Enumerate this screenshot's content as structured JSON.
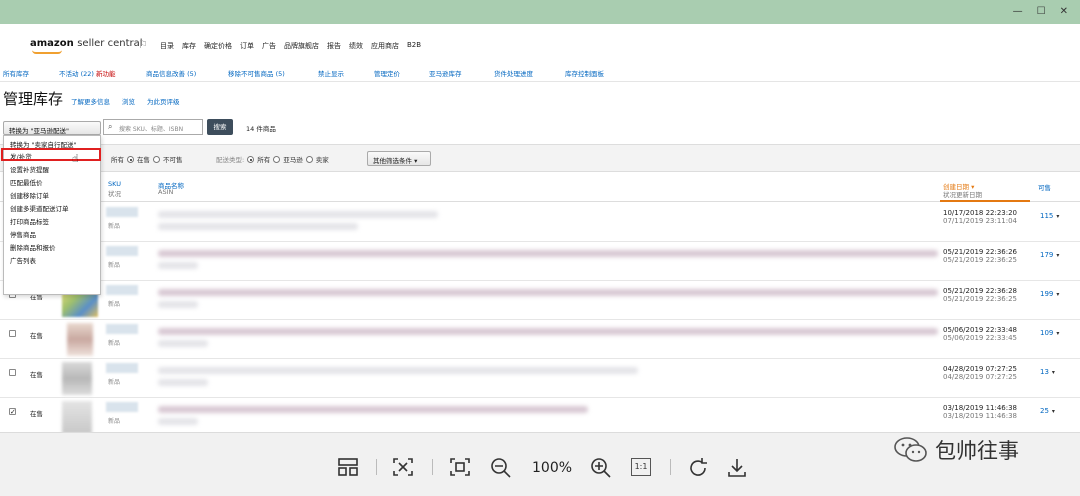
{
  "window": {
    "controls": [
      "—",
      "☐",
      "✕"
    ]
  },
  "header": {
    "logo_brand": "amazon",
    "logo_product": "seller central",
    "nav": [
      "目录",
      "库存",
      "确定价格",
      "订单",
      "广告",
      "品牌旗舰店",
      "报告",
      "绩效",
      "应用商店",
      "B2B"
    ]
  },
  "subnav": {
    "all_inventory": "所有库存",
    "inactive": "不活动 (22)",
    "inactive_badge": "新功能",
    "listing_quality": "商品信息改善 (5)",
    "remove_unsellable": "移除不可售商品 (5)",
    "suppressed": "禁止显示",
    "manage_pricing": "管理定价",
    "fba_inventory": "亚马逊库存",
    "shipments": "货件处理进度",
    "inventory_dashboard": "库存控制面板"
  },
  "page": {
    "title": "管理库存",
    "learn_more": "了解更多信息",
    "tour": "浏览",
    "rate_page": "为此页评级"
  },
  "toolbar": {
    "bulk_action": "转换为 \"亚马逊配送\"",
    "search_placeholder": "搜索 SKU、标题、ISBN",
    "search_button": "搜索",
    "result_count": "14 件商品"
  },
  "filters": {
    "all": "所有",
    "active": "在售",
    "inactive": "不可售",
    "fulfillment_label": "配送类型:",
    "fulfill_all": "所有",
    "fulfill_amazon": "亚马逊",
    "fulfill_merchant": "卖家",
    "more_filters": "其他筛选条件 ▾"
  },
  "table": {
    "col_sku": "SKU",
    "col_status": "状况",
    "col_title": "商品名称",
    "col_asin": "ASIN",
    "col_date": "创建日期 ▾",
    "col_date_sub": "状况更新日期",
    "col_available": "可售"
  },
  "rows": [
    {
      "status": "",
      "condition": "新品",
      "checked": false,
      "date_created": "10/17/2018 22:23:20",
      "date_updated": "07/11/2019 23:11:04",
      "available": "115"
    },
    {
      "status": "",
      "condition": "新品",
      "checked": false,
      "date_created": "05/21/2019 22:36:26",
      "date_updated": "05/21/2019 22:36:25",
      "available": "179"
    },
    {
      "status": "在售",
      "condition": "新品",
      "checked": false,
      "date_created": "05/21/2019 22:36:28",
      "date_updated": "05/21/2019 22:36:25",
      "available": "199"
    },
    {
      "status": "在售",
      "condition": "新品",
      "checked": false,
      "date_created": "05/06/2019 22:33:48",
      "date_updated": "05/06/2019 22:33:45",
      "available": "109"
    },
    {
      "status": "在售",
      "condition": "新品",
      "checked": false,
      "date_created": "04/28/2019 07:27:25",
      "date_updated": "04/28/2019 07:27:25",
      "available": "13"
    },
    {
      "status": "在售",
      "condition": "新品",
      "checked": true,
      "date_created": "03/18/2019 11:46:38",
      "date_updated": "03/18/2019 11:46:38",
      "available": "25"
    }
  ],
  "dropdown": {
    "items": [
      "转换为 \"卖家自行配送\"",
      "发/补货",
      "设置补货提醒",
      "匹配最低价",
      "创建移除订单",
      "创建多渠道配送订单",
      "打印商品标签",
      "停售商品",
      "删除商品和报价",
      "广告列表"
    ]
  },
  "viewer": {
    "zoom": "100%",
    "one_to_one": "1:1",
    "watermark": "包帅往事"
  },
  "colors": {
    "titlebar": "#a9cdb0",
    "link": "#0066c0",
    "highlight": "#e02020",
    "sort_accent": "#e47911"
  }
}
